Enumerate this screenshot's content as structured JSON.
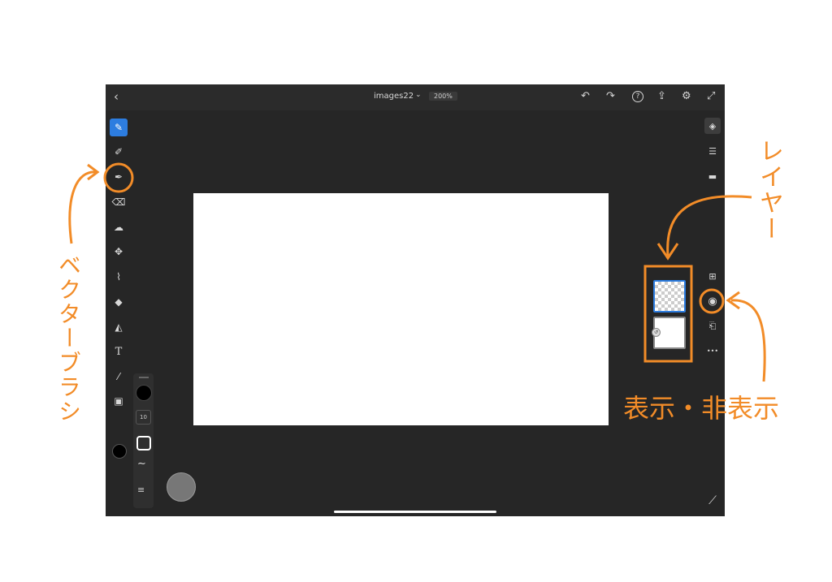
{
  "topbar": {
    "back_icon": "chevron-left-icon",
    "back_glyph": "‹",
    "document_name": "images22",
    "doc_menu_glyph": "⌄",
    "zoom": "200%",
    "actions": [
      {
        "name": "undo-icon",
        "glyph": "↶"
      },
      {
        "name": "redo-icon",
        "glyph": "↷"
      },
      {
        "name": "help-icon",
        "glyph": "?"
      },
      {
        "name": "share-icon",
        "glyph": "⇪"
      },
      {
        "name": "settings-icon",
        "glyph": "⚙"
      },
      {
        "name": "fullscreen-icon",
        "glyph": "⤢"
      }
    ]
  },
  "left_toolbar": {
    "tools": [
      {
        "name": "pixel-brush-tool-icon",
        "glyph": "✎",
        "active": true
      },
      {
        "name": "live-brush-tool-icon",
        "glyph": "✐"
      },
      {
        "name": "vector-brush-tool-icon",
        "glyph": "✒"
      },
      {
        "name": "eraser-tool-icon",
        "glyph": "⌫"
      },
      {
        "name": "smudge-tool-icon",
        "glyph": "☁"
      },
      {
        "name": "transform-tool-icon",
        "glyph": "✥"
      },
      {
        "name": "lasso-tool-icon",
        "glyph": "⌇"
      },
      {
        "name": "fill-tool-icon",
        "glyph": "◆"
      },
      {
        "name": "shape-tool-icon",
        "glyph": "◭"
      },
      {
        "name": "text-tool-icon",
        "glyph": "T"
      },
      {
        "name": "eyedropper-tool-icon",
        "glyph": "⁄"
      },
      {
        "name": "image-tool-icon",
        "glyph": "▣"
      }
    ],
    "color": "#000000"
  },
  "brush_properties": {
    "size": "10",
    "wave_glyph": "∼",
    "settings_glyph": "≡"
  },
  "right_toolbar": {
    "top_icons": [
      {
        "name": "layers-icon",
        "glyph": "◈",
        "active": true
      },
      {
        "name": "adjustments-icon",
        "glyph": "☰"
      },
      {
        "name": "comments-icon",
        "glyph": "▬"
      }
    ],
    "layer_icons": [
      {
        "name": "add-layer-icon",
        "glyph": "⊞"
      },
      {
        "name": "visibility-eye-icon",
        "glyph": "◉"
      },
      {
        "name": "merge-down-icon",
        "glyph": "⎗"
      },
      {
        "name": "more-options-icon",
        "glyph": "•••"
      }
    ],
    "bottom_icon": {
      "name": "ruler-icon",
      "glyph": "⟋"
    }
  },
  "layers": [
    {
      "name": "layer-1",
      "selected": true
    },
    {
      "name": "layer-2",
      "selected": false,
      "badge": "↺"
    }
  ],
  "annotations": {
    "vector_brush": "ベクターブラシ",
    "layer": "レイヤー",
    "show_hide": "表示・非表示",
    "color": "#f28c28"
  }
}
